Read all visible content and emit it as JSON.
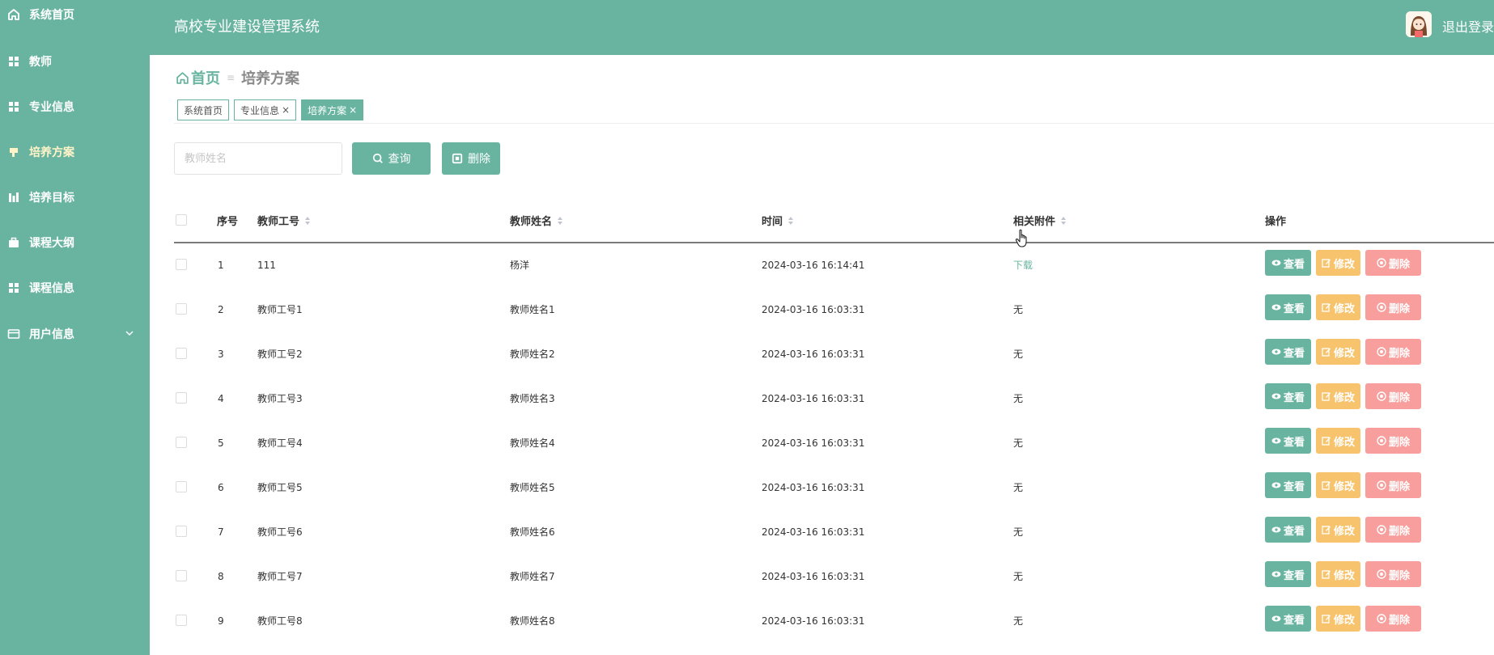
{
  "sidebar": {
    "items": [
      {
        "label": "系统首页",
        "icon": "home-icon"
      },
      {
        "label": "教师",
        "icon": "grid-icon"
      },
      {
        "label": "专业信息",
        "icon": "grid-icon"
      },
      {
        "label": "培养方案",
        "icon": "flag-icon",
        "active": true
      },
      {
        "label": "培养目标",
        "icon": "chart-icon"
      },
      {
        "label": "课程大纲",
        "icon": "briefcase-icon"
      },
      {
        "label": "课程信息",
        "icon": "grid-icon"
      },
      {
        "label": "用户信息",
        "icon": "card-icon",
        "expandable": true
      }
    ]
  },
  "header": {
    "title": "高校专业建设管理系统",
    "logout_label": "退出登录"
  },
  "breadcrumb": {
    "home": "首页",
    "separator": "≡",
    "current": "培养方案"
  },
  "tags": [
    {
      "label": "系统首页",
      "closable": false
    },
    {
      "label": "专业信息",
      "closable": true
    },
    {
      "label": "培养方案",
      "closable": true,
      "active": true
    }
  ],
  "toolbar": {
    "search_placeholder": "教师姓名",
    "search_value": "",
    "query_label": "查询",
    "delete_label": "删除"
  },
  "table": {
    "columns": {
      "index": "序号",
      "teacher_id": "教师工号",
      "teacher_name": "教师姓名",
      "time": "时间",
      "attachment": "相关附件",
      "actions": "操作"
    },
    "rows": [
      {
        "index": "1",
        "teacher_id": "111",
        "teacher_name": "杨洋",
        "time": "2024-03-16 16:14:41",
        "attachment": "下载",
        "attachment_is_link": true
      },
      {
        "index": "2",
        "teacher_id": "教师工号1",
        "teacher_name": "教师姓名1",
        "time": "2024-03-16 16:03:31",
        "attachment": "无"
      },
      {
        "index": "3",
        "teacher_id": "教师工号2",
        "teacher_name": "教师姓名2",
        "time": "2024-03-16 16:03:31",
        "attachment": "无"
      },
      {
        "index": "4",
        "teacher_id": "教师工号3",
        "teacher_name": "教师姓名3",
        "time": "2024-03-16 16:03:31",
        "attachment": "无"
      },
      {
        "index": "5",
        "teacher_id": "教师工号4",
        "teacher_name": "教师姓名4",
        "time": "2024-03-16 16:03:31",
        "attachment": "无"
      },
      {
        "index": "6",
        "teacher_id": "教师工号5",
        "teacher_name": "教师姓名5",
        "time": "2024-03-16 16:03:31",
        "attachment": "无"
      },
      {
        "index": "7",
        "teacher_id": "教师工号6",
        "teacher_name": "教师姓名6",
        "time": "2024-03-16 16:03:31",
        "attachment": "无"
      },
      {
        "index": "8",
        "teacher_id": "教师工号7",
        "teacher_name": "教师姓名7",
        "time": "2024-03-16 16:03:31",
        "attachment": "无"
      },
      {
        "index": "9",
        "teacher_id": "教师工号8",
        "teacher_name": "教师姓名8",
        "time": "2024-03-16 16:03:31",
        "attachment": "无"
      }
    ],
    "row_actions": {
      "view": "查看",
      "edit": "修改",
      "delete": "删除"
    }
  },
  "colors": {
    "primary": "#69b4a0",
    "edit": "#f7c36c",
    "delete": "#f89e9c",
    "active_nav": "#fff4c8"
  }
}
